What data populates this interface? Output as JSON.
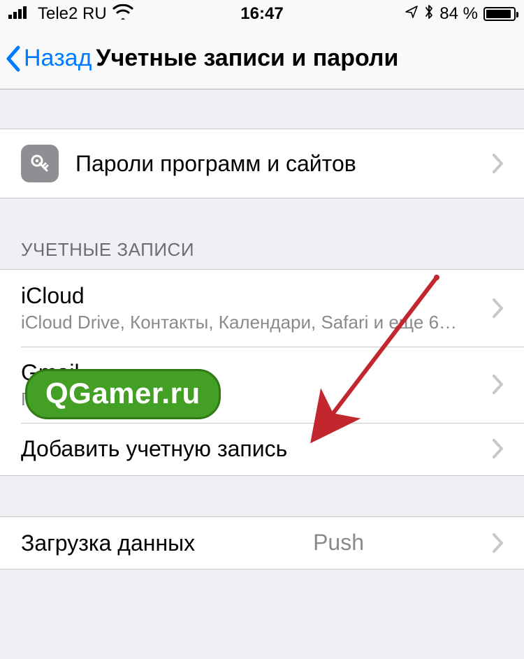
{
  "status": {
    "carrier": "Tele2 RU",
    "time": "16:47",
    "battery_pct": "84 %"
  },
  "nav": {
    "back_label": "Назад",
    "title": "Учетные записи и пароли"
  },
  "passwords_row": {
    "label": "Пароли программ и сайтов"
  },
  "accounts_section": {
    "header": "УЧЕТНЫЕ ЗАПИСИ",
    "icloud": {
      "title": "iCloud",
      "subtitle": "iCloud Drive, Контакты, Календари, Safari и еще 6…"
    },
    "gmail": {
      "title": "Gmail",
      "subtitle": "Почта"
    },
    "add_account": {
      "title": "Добавить учетную запись"
    }
  },
  "fetch_section": {
    "title": "Загрузка данных",
    "value": "Push"
  },
  "watermark": "QGamer.ru"
}
